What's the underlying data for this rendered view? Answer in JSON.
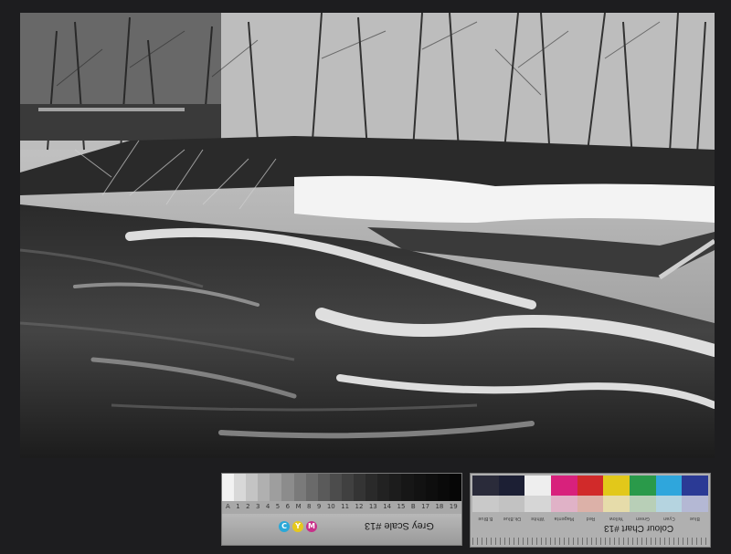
{
  "grey_scale_card": {
    "title": "Grey Scale #13",
    "letters": [
      "A",
      "1",
      "2",
      "3",
      "4",
      "5",
      "6",
      "M",
      "8",
      "9",
      "10",
      "11",
      "12",
      "13",
      "14",
      "15",
      "B",
      "17",
      "18",
      "19"
    ],
    "cmy": [
      "C",
      "Y",
      "M"
    ],
    "steps": [
      "#f2f2f2",
      "#d8d8d8",
      "#c4c4c4",
      "#b0b0b0",
      "#9e9e9e",
      "#8c8c8c",
      "#7a7a7a",
      "#6a6a6a",
      "#5a5a5a",
      "#4c4c4c",
      "#404040",
      "#343434",
      "#2a2a2a",
      "#222222",
      "#1c1c1c",
      "#161616",
      "#121212",
      "#0e0e0e",
      "#0a0a0a",
      "#060606"
    ]
  },
  "colour_chart_card": {
    "title": "Colour Chart #13",
    "top_colors": [
      "#2a2b3a",
      "#1c1f34",
      "#eeeeee",
      "#d8217c",
      "#d12a2a",
      "#e2c81a",
      "#2a9a4a",
      "#2fa6dc",
      "#2b3a95"
    ],
    "mid_colors": [
      "#c9c9c9",
      "#c2c2c2",
      "#d6d6d6",
      "#e0b2c7",
      "#dcb1a8",
      "#e6dcaa",
      "#b8cfb7",
      "#b5d4e0",
      "#b4b8d4"
    ],
    "names": [
      "B.Blue",
      "Dk.Blue",
      "White",
      "Magenta",
      "Red",
      "Yellow",
      "Green",
      "Cyan",
      "Blue"
    ]
  }
}
